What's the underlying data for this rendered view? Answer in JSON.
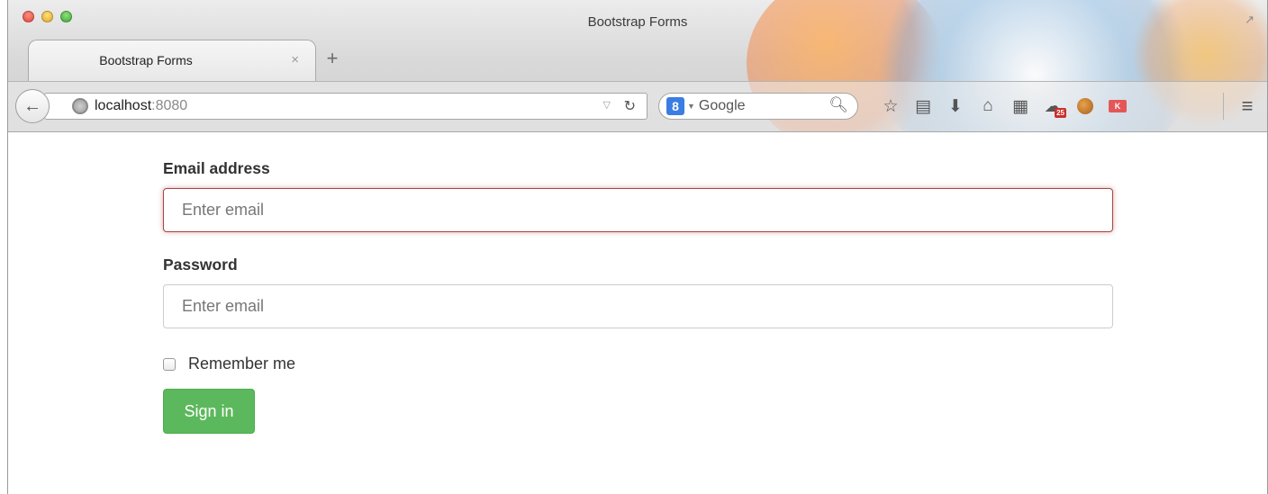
{
  "window": {
    "title": "Bootstrap Forms"
  },
  "tab": {
    "label": "Bootstrap Forms",
    "close_glyph": "×",
    "new_tab_glyph": "+"
  },
  "navbar": {
    "back_glyph": "←",
    "url_host": "localhost",
    "url_port": ":8080",
    "url_dropdown_glyph": "▽",
    "reload_glyph": "C",
    "search_engine_badge": "8",
    "search_placeholder": "Google",
    "search_glyph": "⚲",
    "toolbar_icons": [
      "star-icon",
      "reading-list-icon",
      "download-icon",
      "home-icon",
      "apps-grid-icon",
      "extension-icon",
      "cookie-icon",
      "k-extension-icon"
    ],
    "extension_badge": "25",
    "k_badge": "K",
    "menu_glyph": "≡"
  },
  "form": {
    "email_label": "Email address",
    "email_placeholder": "Enter email",
    "email_state": "error",
    "password_label": "Password",
    "password_placeholder": "Enter email",
    "remember_label": "Remember me",
    "remember_checked": false,
    "submit_label": "Sign in"
  },
  "colors": {
    "error_border": "#a94442",
    "success_button": "#5cb85c",
    "label_text": "#333333"
  }
}
